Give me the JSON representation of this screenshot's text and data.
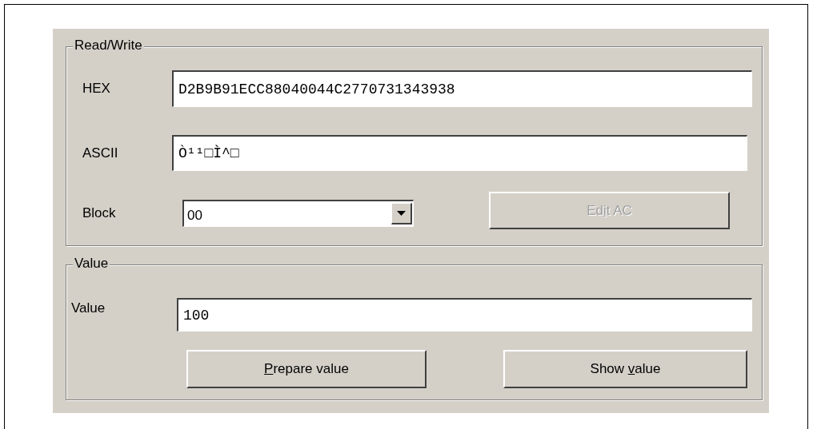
{
  "read_write": {
    "title": "Read/Write",
    "hex": {
      "label": "HEX",
      "value": "D2B9B91ECC88040044C2770731343938"
    },
    "ascii": {
      "label": "ASCII",
      "value": "Ò¹¹□Ì^□"
    },
    "block": {
      "label": "Block",
      "value": "00"
    },
    "edit_ac_button": {
      "before": "Ed",
      "key": "i",
      "after": "t AC",
      "disabled": true
    }
  },
  "value_group": {
    "title": "Value",
    "value": {
      "label": "Value",
      "value": "100"
    },
    "buttons": [
      {
        "key": "P",
        "after": "repare value",
        "disabled": false
      },
      {
        "before": "Show ",
        "key": "v",
        "after": "alue",
        "disabled": false
      }
    ]
  }
}
